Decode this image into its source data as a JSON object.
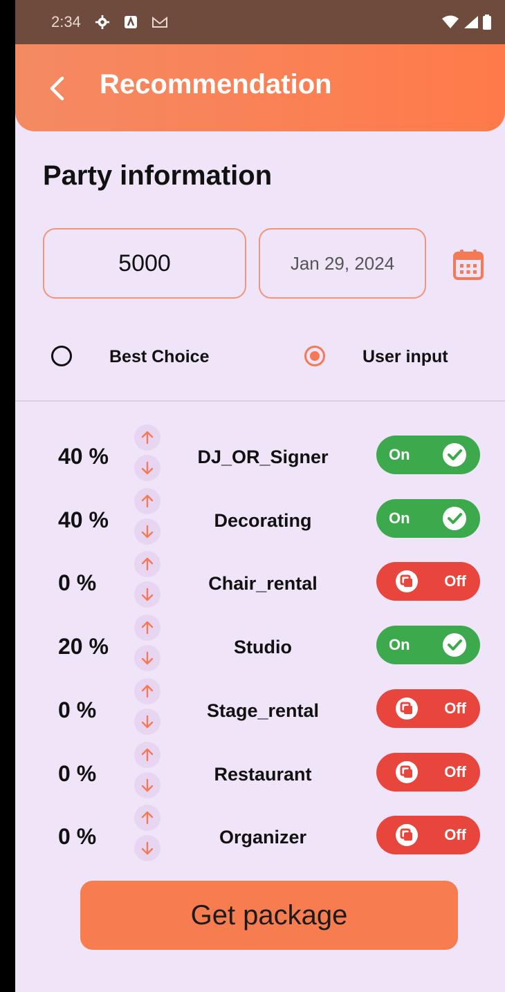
{
  "status_bar": {
    "time": "2:34",
    "icons": [
      "gear-icon",
      "app-icon",
      "gmail-icon",
      "wifi-icon",
      "signal-icon",
      "battery-icon"
    ]
  },
  "app_bar": {
    "title": "Recommendation",
    "back_icon": "chevron-left-icon"
  },
  "section": {
    "title": "Party information"
  },
  "form": {
    "budget_value": "5000",
    "date_value": "Jan 29, 2024",
    "calendar_icon": "calendar-icon"
  },
  "mode": {
    "options": [
      {
        "label": "Best Choice",
        "selected": false
      },
      {
        "label": "User input",
        "selected": true
      }
    ]
  },
  "services": [
    {
      "percent": "40 %",
      "name": "DJ_OR_Signer",
      "toggle": "On",
      "enabled": true
    },
    {
      "percent": "40 %",
      "name": "Decorating",
      "toggle": "On",
      "enabled": true
    },
    {
      "percent": "0 %",
      "name": "Chair_rental",
      "toggle": "Off",
      "enabled": false
    },
    {
      "percent": "20 %",
      "name": "Studio",
      "toggle": "On",
      "enabled": true
    },
    {
      "percent": "0 %",
      "name": "Stage_rental",
      "toggle": "Off",
      "enabled": false
    },
    {
      "percent": "0 %",
      "name": "Restaurant",
      "toggle": "Off",
      "enabled": false
    },
    {
      "percent": "0 %",
      "name": "Organizer",
      "toggle": "Off",
      "enabled": false
    }
  ],
  "cta": {
    "label": "Get package"
  },
  "colors": {
    "accent": "#f77c4f",
    "on": "#3caa4c",
    "off": "#e8453c",
    "background": "#efe4f8"
  }
}
